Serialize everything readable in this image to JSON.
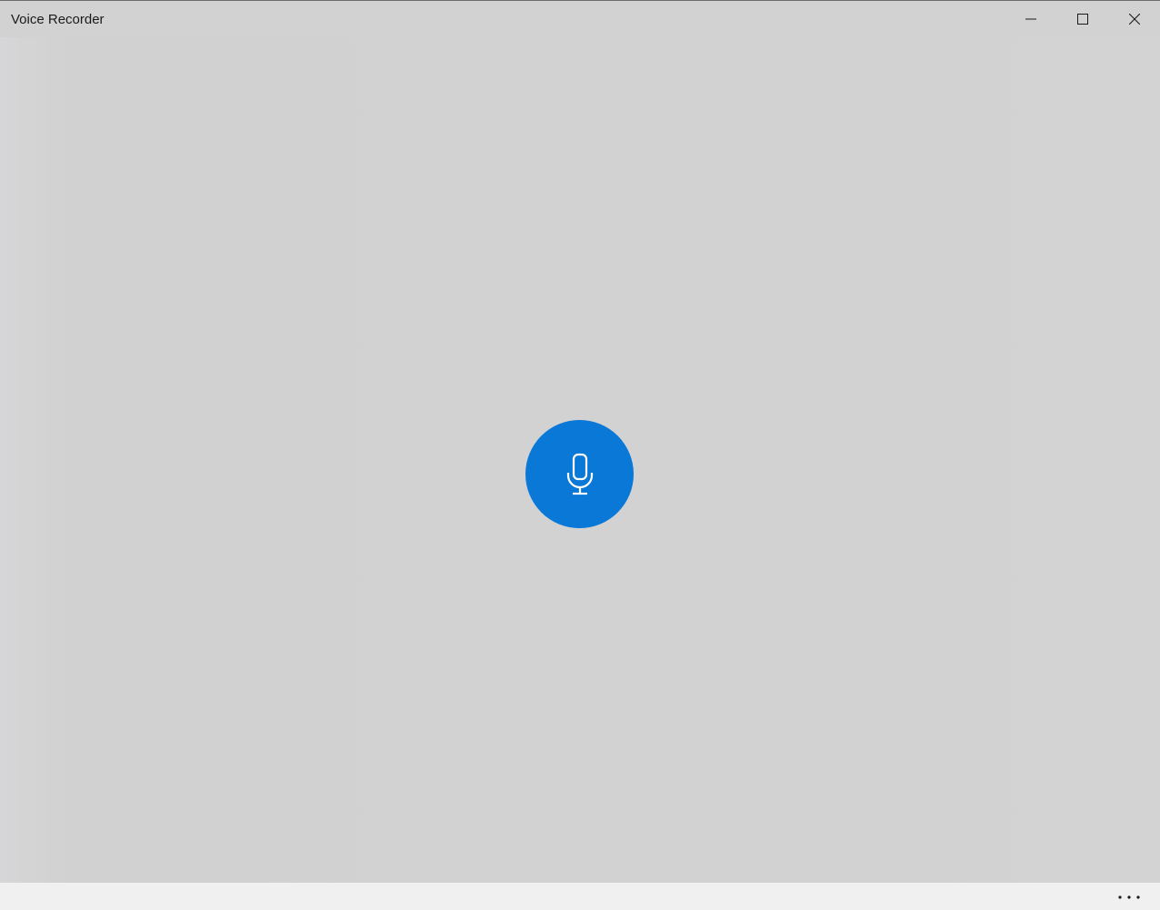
{
  "window": {
    "title": "Voice Recorder"
  },
  "titlebar": {
    "minimize_icon": "minimize-icon",
    "maximize_icon": "maximize-icon",
    "close_icon": "close-icon"
  },
  "main": {
    "record_icon": "microphone-icon"
  },
  "bottom_bar": {
    "more_label": "...",
    "more_icon": "more-icon"
  },
  "colors": {
    "background": "#d2d2d2",
    "accent": "#0a78d7",
    "bottom_bar": "#f0f0f0",
    "title_text": "#1a1a1a"
  }
}
